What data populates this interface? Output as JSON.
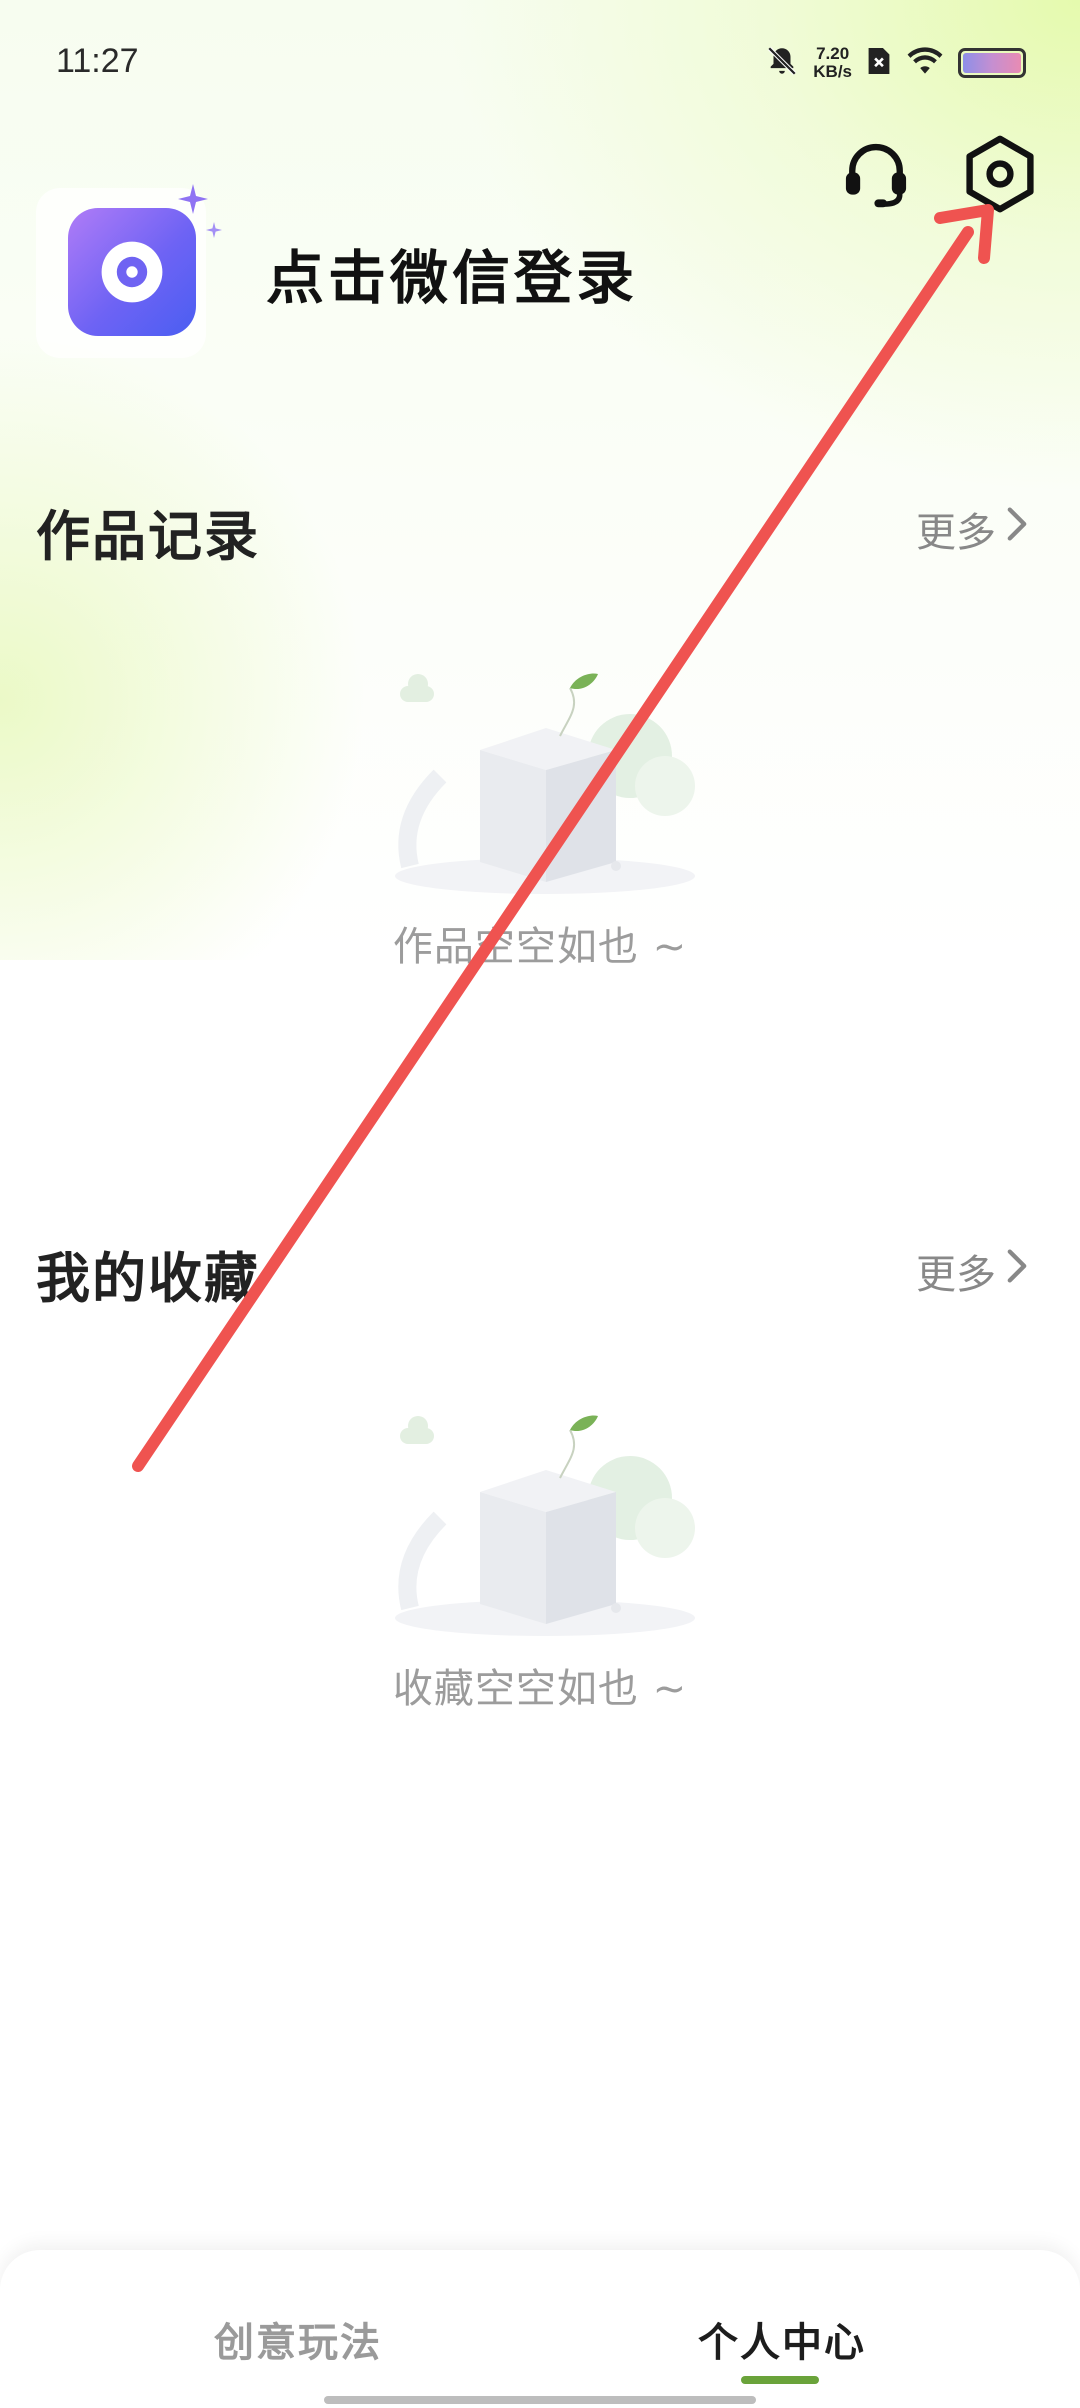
{
  "status_bar": {
    "time": "11:27",
    "net_speed": "7.20",
    "net_unit": "KB/s"
  },
  "profile": {
    "login_text": "点击微信登录"
  },
  "sections": {
    "works": {
      "title": "作品记录",
      "more": "更多",
      "empty": "作品空空如也 ~"
    },
    "favorites": {
      "title": "我的收藏",
      "more": "更多",
      "empty": "收藏空空如也 ~"
    }
  },
  "tabbar": {
    "tabs": [
      {
        "label": "创意玩法",
        "active": false
      },
      {
        "label": "个人中心",
        "active": true
      }
    ]
  },
  "icons": {
    "support": "headset-icon",
    "settings": "settings-hexagon-icon",
    "mute": "bell-off-icon",
    "wifi": "wifi-icon",
    "battery": "battery-icon"
  },
  "colors": {
    "accent_green": "#6aa33a",
    "annotation_arrow": "#ef5350",
    "avatar_gradient": [
      "#b07cf7",
      "#4a5ef2"
    ]
  }
}
